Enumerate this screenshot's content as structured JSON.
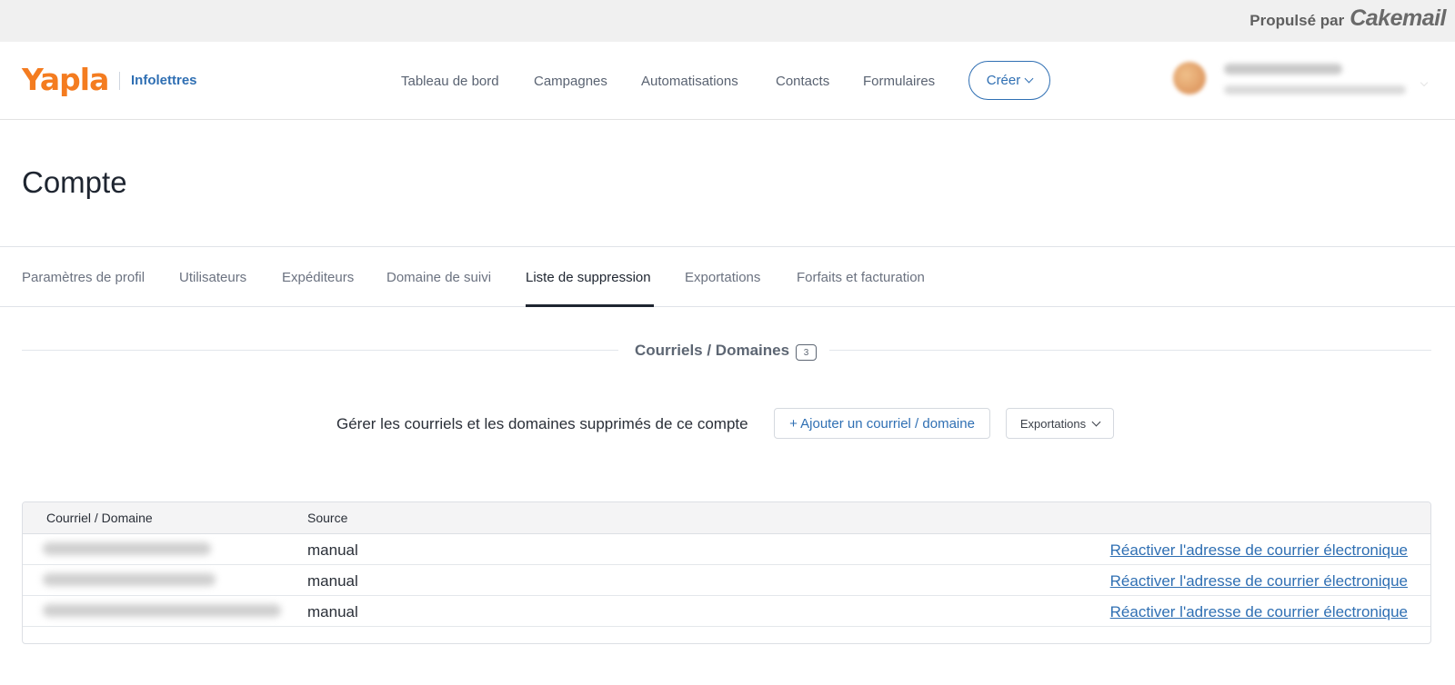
{
  "powered": {
    "prefix": "Propulsé par",
    "brand": "Cakemail"
  },
  "header": {
    "logo": "Yapla",
    "product": "Infolettres",
    "nav": [
      "Tableau de bord",
      "Campagnes",
      "Automatisations",
      "Contacts",
      "Formulaires"
    ],
    "create_label": "Créer",
    "user_icon": "avatar-icon"
  },
  "page": {
    "title": "Compte"
  },
  "tabs": [
    "Paramètres de profil",
    "Utilisateurs",
    "Expéditeurs",
    "Domaine de suivi",
    "Liste de suppression",
    "Exportations",
    "Forfaits et facturation"
  ],
  "active_tab": "Liste de suppression",
  "section": {
    "title": "Courriels / Domaines",
    "count": "3"
  },
  "actions": {
    "description": "Gérer les courriels et les domaines supprimés de ce compte",
    "add_label": "+ Ajouter un courriel / domaine",
    "export_label": "Exportations"
  },
  "table": {
    "headers": [
      "Courriel / Domaine",
      "Source"
    ],
    "rows": [
      {
        "source": "manual",
        "action": "Réactiver l'adresse de courrier électronique"
      },
      {
        "source": "manual",
        "action": "Réactiver l'adresse de courrier électronique"
      },
      {
        "source": "manual",
        "action": "Réactiver l'adresse de courrier électronique"
      }
    ]
  },
  "colors": {
    "brand_orange": "#f47c20",
    "accent_blue": "#2f6fb3",
    "text_dark": "#1e2530"
  }
}
